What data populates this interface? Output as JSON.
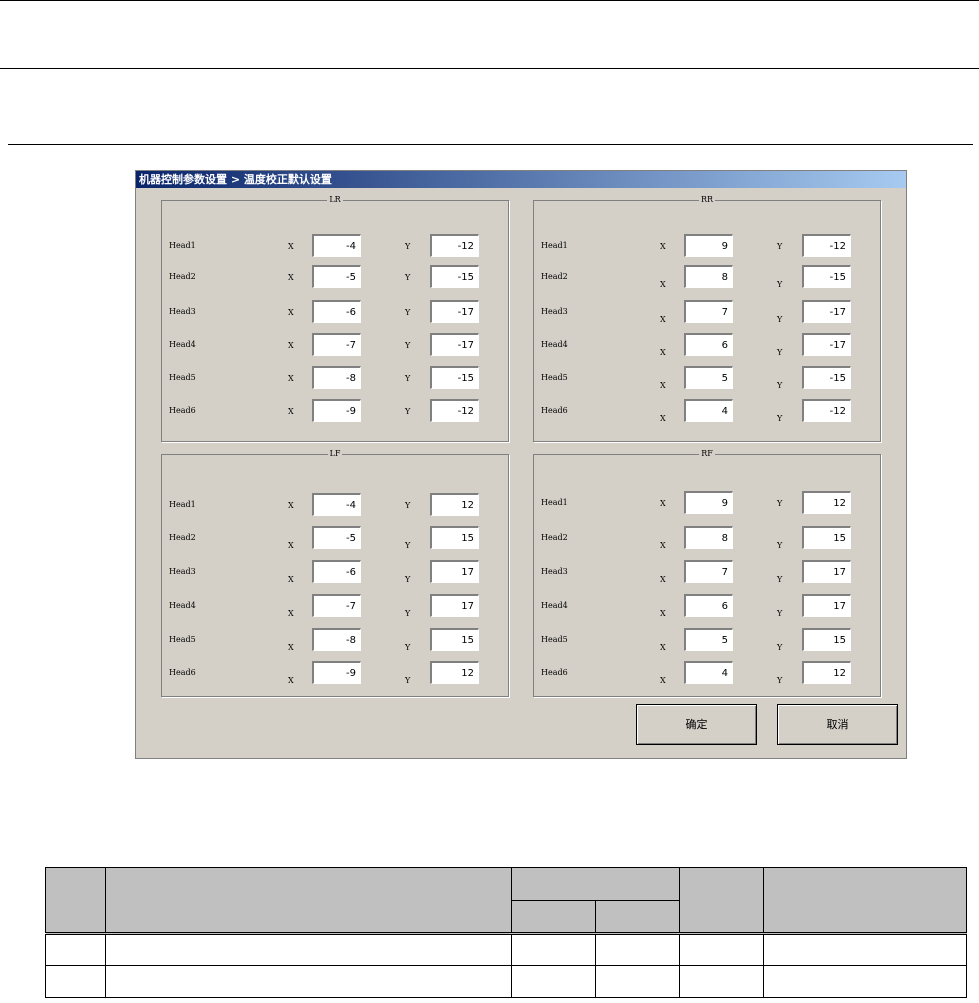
{
  "dialog": {
    "title": "机器控制参数设置 > 温度校正默认设置",
    "buttons": {
      "ok": "确定",
      "cancel": "取消"
    }
  },
  "groups": [
    {
      "id": "lr",
      "title": "LR",
      "rows": [
        {
          "label": "Head1",
          "x_label": "X",
          "x": "-4",
          "y_label": "Y",
          "y": "-12"
        },
        {
          "label": "Head2",
          "x_label": "X",
          "x": "-5",
          "y_label": "Y",
          "y": "-15"
        },
        {
          "label": "Head3",
          "x_label": "X",
          "x": "-6",
          "y_label": "Y",
          "y": "-17"
        },
        {
          "label": "Head4",
          "x_label": "X",
          "x": "-7",
          "y_label": "Y",
          "y": "-17"
        },
        {
          "label": "Head5",
          "x_label": "X",
          "x": "-8",
          "y_label": "Y",
          "y": "-15"
        },
        {
          "label": "Head6",
          "x_label": "X",
          "x": "-9",
          "y_label": "Y",
          "y": "-12"
        }
      ]
    },
    {
      "id": "rr",
      "title": "RR",
      "rows": [
        {
          "label": "Head1",
          "x_label": "X",
          "x": "9",
          "y_label": "Y",
          "y": "-12"
        },
        {
          "label": "Head2",
          "x_label": "X",
          "x": "8",
          "y_label": "Y",
          "y": "-15"
        },
        {
          "label": "Head3",
          "x_label": "X",
          "x": "7",
          "y_label": "Y",
          "y": "-17"
        },
        {
          "label": "Head4",
          "x_label": "X",
          "x": "6",
          "y_label": "Y",
          "y": "-17"
        },
        {
          "label": "Head5",
          "x_label": "X",
          "x": "5",
          "y_label": "Y",
          "y": "-15"
        },
        {
          "label": "Head6",
          "x_label": "X",
          "x": "4",
          "y_label": "Y",
          "y": "-12"
        }
      ]
    },
    {
      "id": "lf",
      "title": "LF",
      "rows": [
        {
          "label": "Head1",
          "x_label": "X",
          "x": "-4",
          "y_label": "Y",
          "y": "12"
        },
        {
          "label": "Head2",
          "x_label": "X",
          "x": "-5",
          "y_label": "Y",
          "y": "15"
        },
        {
          "label": "Head3",
          "x_label": "X",
          "x": "-6",
          "y_label": "Y",
          "y": "17"
        },
        {
          "label": "Head4",
          "x_label": "X",
          "x": "-7",
          "y_label": "Y",
          "y": "17"
        },
        {
          "label": "Head5",
          "x_label": "X",
          "x": "-8",
          "y_label": "Y",
          "y": "15"
        },
        {
          "label": "Head6",
          "x_label": "X",
          "x": "-9",
          "y_label": "Y",
          "y": "12"
        }
      ]
    },
    {
      "id": "rf",
      "title": "RF",
      "rows": [
        {
          "label": "Head1",
          "x_label": "X",
          "x": "9",
          "y_label": "Y",
          "y": "12"
        },
        {
          "label": "Head2",
          "x_label": "X",
          "x": "8",
          "y_label": "Y",
          "y": "15"
        },
        {
          "label": "Head3",
          "x_label": "X",
          "x": "7",
          "y_label": "Y",
          "y": "17"
        },
        {
          "label": "Head4",
          "x_label": "X",
          "x": "6",
          "y_label": "Y",
          "y": "17"
        },
        {
          "label": "Head5",
          "x_label": "X",
          "x": "5",
          "y_label": "Y",
          "y": "15"
        },
        {
          "label": "Head6",
          "x_label": "X",
          "x": "4",
          "y_label": "Y",
          "y": "12"
        }
      ]
    }
  ]
}
